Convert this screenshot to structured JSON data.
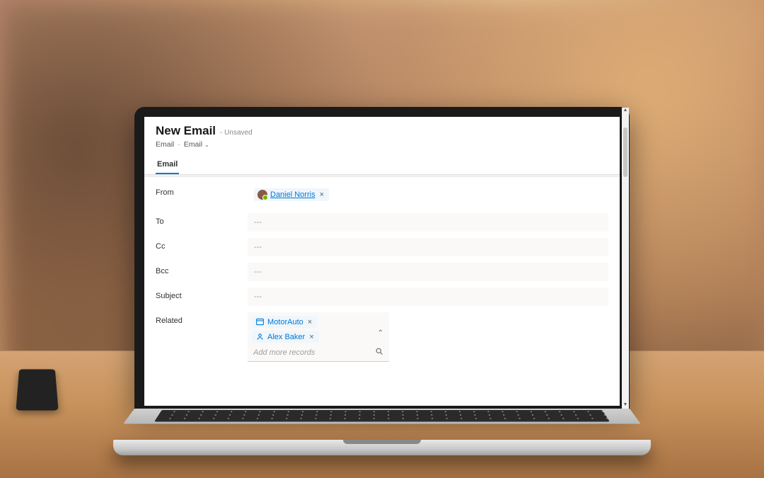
{
  "header": {
    "title": "New Email",
    "status": "- Unsaved",
    "breadcrumbs": {
      "entity": "Email",
      "form": "Email"
    }
  },
  "tabs": [
    {
      "label": "Email",
      "active": true
    }
  ],
  "fields": {
    "from": {
      "label": "From",
      "chip": {
        "name": "Daniel Norris"
      }
    },
    "to": {
      "label": "To",
      "placeholder": "---"
    },
    "cc": {
      "label": "Cc",
      "placeholder": "---"
    },
    "bcc": {
      "label": "Bcc",
      "placeholder": "---"
    },
    "subject": {
      "label": "Subject",
      "placeholder": "---"
    },
    "related": {
      "label": "Related",
      "chips": [
        {
          "name": "MotorAuto",
          "icon": "account"
        },
        {
          "name": "Alex Baker",
          "icon": "contact"
        }
      ],
      "lookup_placeholder": "Add more records"
    }
  }
}
